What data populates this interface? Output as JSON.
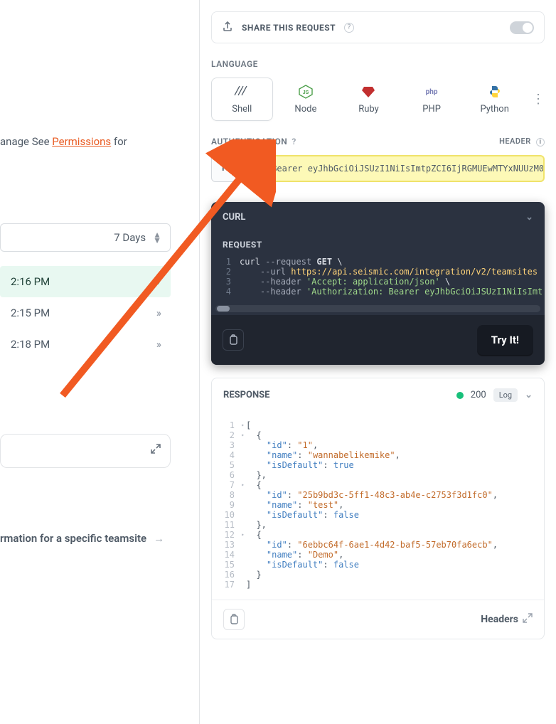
{
  "left": {
    "manage_prefix": "anage",
    "see_text": " See ",
    "permissions_link": "Permissions",
    "suffix": " for",
    "range_label": "7 Days",
    "times": [
      "2:16 PM",
      "2:15 PM",
      "2:18 PM"
    ],
    "bottom_link": "rmation for a specific teamsite"
  },
  "share": {
    "label": "SHARE THIS REQUEST"
  },
  "language": {
    "label": "LANGUAGE",
    "items": [
      "Shell",
      "Node",
      "Ruby",
      "PHP",
      "Python"
    ]
  },
  "auth": {
    "label": "AUTHENTICATION",
    "mode": "HEADER",
    "button": "Header",
    "value": "Bearer eyJhbGciOiJSUzI1NiIsImtpZCI6IjRGMUEwMTYxNUUzM0"
  },
  "code": {
    "title": "CURL",
    "section": "REQUEST",
    "lines": [
      {
        "n": "1",
        "html": "<span class='tk-cmd'>curl</span> <span class='tk-flag'>--request</span> <span class='tk-method'>GET</span> <span class='tk-esc'>\\</span>"
      },
      {
        "n": "2",
        "html": "&nbsp;&nbsp;&nbsp;&nbsp;<span class='tk-flag'>--url</span> <span class='tk-url'>https://api.seismic.com/integration/v2/teamsites</span>"
      },
      {
        "n": "3",
        "html": "&nbsp;&nbsp;&nbsp;&nbsp;<span class='tk-flag'>--header</span> <span class='tk-str'>'Accept: application/json'</span> <span class='tk-esc'>\\</span>"
      },
      {
        "n": "4",
        "html": "&nbsp;&nbsp;&nbsp;&nbsp;<span class='tk-flag'>--header</span> <span class='tk-str'>'Authorization: Bearer eyJhbGciOiJSUzI1NiIsImt</span>"
      }
    ],
    "tryit": "Try It!"
  },
  "response": {
    "label": "RESPONSE",
    "status": "200",
    "log": "Log",
    "headers_btn": "Headers",
    "lines": [
      {
        "n": "1",
        "tri": true,
        "html": "<span class='jp'>[</span>"
      },
      {
        "n": "2",
        "tri": true,
        "html": "&nbsp;&nbsp;<span class='jp'>{</span>"
      },
      {
        "n": "3",
        "html": "&nbsp;&nbsp;&nbsp;&nbsp;<span class='jk'>\"id\"</span><span class='jp'>: </span><span class='js'>\"1\"</span><span class='jp'>,</span>"
      },
      {
        "n": "4",
        "html": "&nbsp;&nbsp;&nbsp;&nbsp;<span class='jk'>\"name\"</span><span class='jp'>: </span><span class='js'>\"wannabelikemike\"</span><span class='jp'>,</span>"
      },
      {
        "n": "5",
        "html": "&nbsp;&nbsp;&nbsp;&nbsp;<span class='jk'>\"isDefault\"</span><span class='jp'>: </span><span class='jb'>true</span>"
      },
      {
        "n": "6",
        "html": "&nbsp;&nbsp;<span class='jp'>},</span>"
      },
      {
        "n": "7",
        "tri": true,
        "html": "&nbsp;&nbsp;<span class='jp'>{</span>"
      },
      {
        "n": "8",
        "html": "&nbsp;&nbsp;&nbsp;&nbsp;<span class='jk'>\"id\"</span><span class='jp'>: </span><span class='js'>\"25b9bd3c-5ff1-48c3-ab4e-c2753f3d1fc0\"</span><span class='jp'>,</span>"
      },
      {
        "n": "9",
        "html": "&nbsp;&nbsp;&nbsp;&nbsp;<span class='jk'>\"name\"</span><span class='jp'>: </span><span class='js'>\"test\"</span><span class='jp'>,</span>"
      },
      {
        "n": "10",
        "html": "&nbsp;&nbsp;&nbsp;&nbsp;<span class='jk'>\"isDefault\"</span><span class='jp'>: </span><span class='jb'>false</span>"
      },
      {
        "n": "11",
        "html": "&nbsp;&nbsp;<span class='jp'>},</span>"
      },
      {
        "n": "12",
        "tri": true,
        "html": "&nbsp;&nbsp;<span class='jp'>{</span>"
      },
      {
        "n": "13",
        "html": "&nbsp;&nbsp;&nbsp;&nbsp;<span class='jk'>\"id\"</span><span class='jp'>: </span><span class='js'>\"6ebbc64f-6ae1-4d42-baf5-57eb70fa6ecb\"</span><span class='jp'>,</span>"
      },
      {
        "n": "14",
        "html": "&nbsp;&nbsp;&nbsp;&nbsp;<span class='jk'>\"name\"</span><span class='jp'>: </span><span class='js'>\"Demo\"</span><span class='jp'>,</span>"
      },
      {
        "n": "15",
        "html": "&nbsp;&nbsp;&nbsp;&nbsp;<span class='jk'>\"isDefault\"</span><span class='jp'>: </span><span class='jb'>false</span>"
      },
      {
        "n": "16",
        "html": "&nbsp;&nbsp;<span class='jp'>}</span>"
      },
      {
        "n": "17",
        "html": "<span class='jp'>]</span>"
      }
    ]
  }
}
